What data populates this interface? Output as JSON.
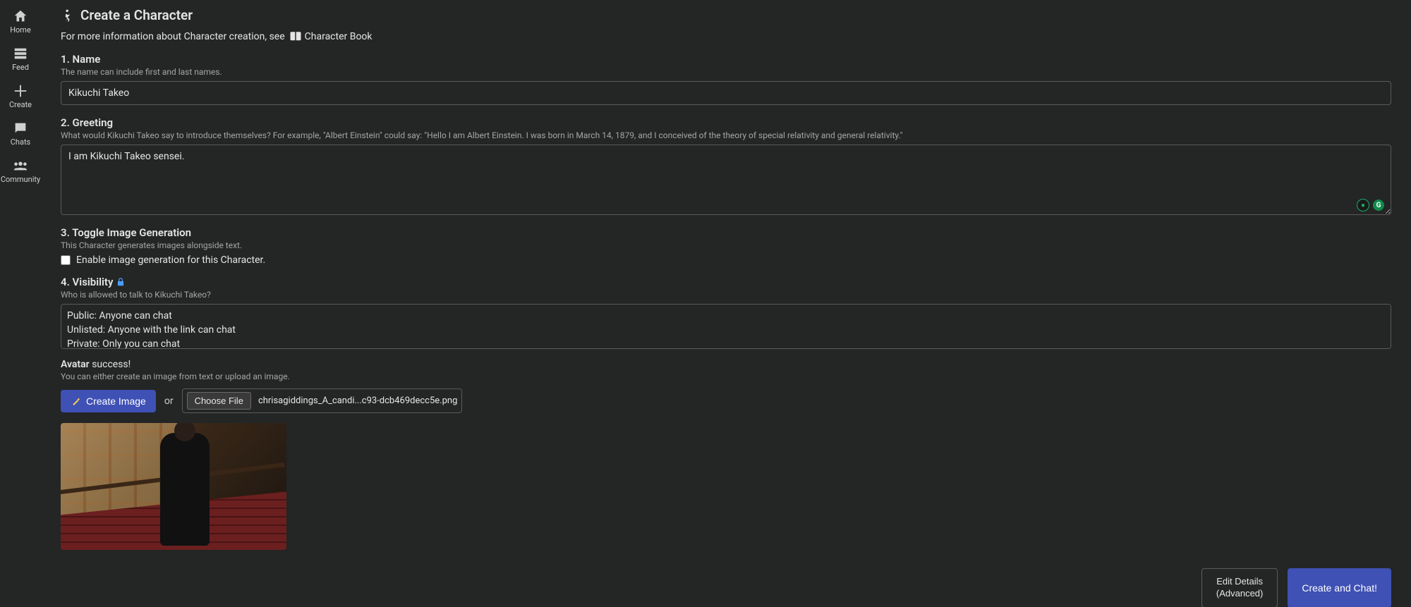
{
  "sidebar": {
    "items": [
      {
        "label": "Home"
      },
      {
        "label": "Feed"
      },
      {
        "label": "Create"
      },
      {
        "label": "Chats"
      },
      {
        "label": "Community"
      }
    ]
  },
  "header": {
    "title": "Create a Character",
    "subtitle_pre": "For more information about Character creation, see",
    "book_link": "Character Book"
  },
  "section_name": {
    "label": "1. Name",
    "hint": "The name can include first and last names.",
    "value": "Kikuchi Takeo"
  },
  "section_greeting": {
    "label": "2. Greeting",
    "hint": "What would Kikuchi Takeo say to introduce themselves? For example, \"Albert Einstein\" could say: \"Hello I am Albert Einstein. I was born in March 14, 1879, and I conceived of the theory of special relativity and general relativity.\"",
    "value": "I am Kikuchi Takeo sensei."
  },
  "section_imagegen": {
    "label": "3. Toggle Image Generation",
    "hint": "This Character generates images alongside text.",
    "checkbox_label": "Enable image generation for this Character."
  },
  "section_visibility": {
    "label": "4. Visibility",
    "hint": "Who is allowed to talk to Kikuchi Takeo?",
    "options": [
      "Public: Anyone can chat",
      "Unlisted: Anyone with the link can chat",
      "Private: Only you can chat"
    ]
  },
  "section_avatar": {
    "label": "Avatar",
    "status": "success!",
    "hint": "You can either create an image from text or upload an image.",
    "create_image_btn": "Create Image",
    "or_text": "or",
    "choose_file_btn": "Choose File",
    "file_name": "chrisagiddings_A_candi...c93-dcb469decc5e.png"
  },
  "footer": {
    "edit_details_line1": "Edit Details",
    "edit_details_line2": "(Advanced)",
    "create_chat": "Create and Chat!"
  }
}
